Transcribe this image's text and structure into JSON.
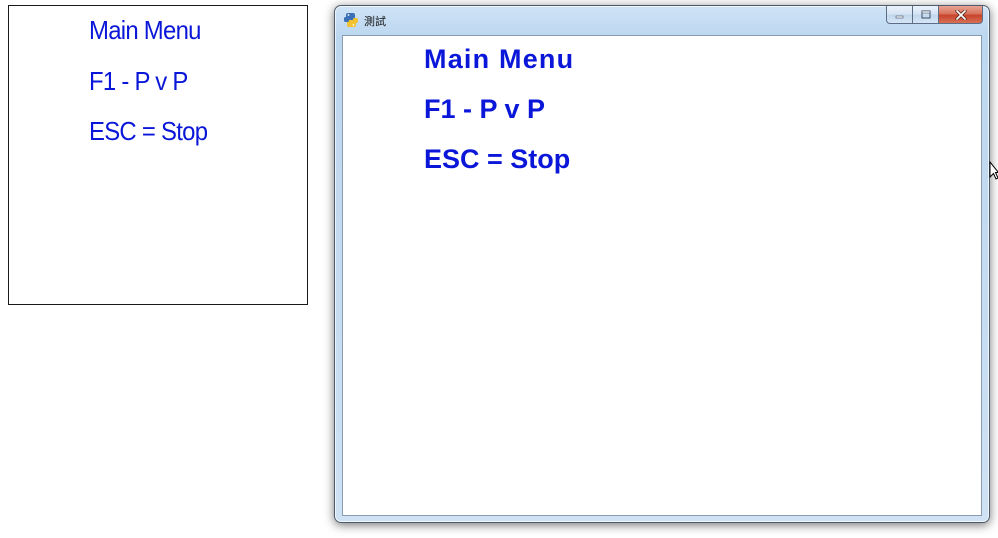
{
  "left_panel": {
    "lines": [
      "Main Menu",
      "F1 - P v P",
      "ESC = Stop"
    ]
  },
  "window": {
    "title": "測試",
    "icon": "python-icon",
    "caption_buttons": {
      "minimize_icon": "minimize-icon",
      "maximize_icon": "maximize-icon",
      "close_icon": "close-icon"
    },
    "lines": [
      "Main Menu",
      "F1 - P v P",
      "ESC = Stop"
    ]
  },
  "colors": {
    "text_blue": "#0b17d8",
    "close_red": "#c7442c",
    "frame_blue": "#c6dcf1"
  }
}
